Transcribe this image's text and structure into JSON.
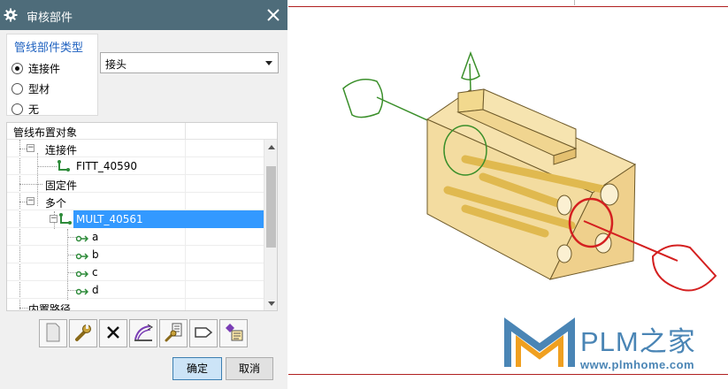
{
  "dialog": {
    "title": "审核部件",
    "part_type_group": {
      "legend": "管线部件类型",
      "options": [
        {
          "label": "连接件",
          "checked": true
        },
        {
          "label": "型材",
          "checked": false
        },
        {
          "label": "无",
          "checked": false
        }
      ]
    },
    "combo": {
      "value": "接头"
    },
    "tree": {
      "header": "管线布置对象",
      "rows": [
        {
          "label": "连接件",
          "expander": "−"
        },
        {
          "label": "FITT_40590"
        },
        {
          "label": "固定件"
        },
        {
          "label": "多个",
          "expander": "−"
        },
        {
          "label": "MULT_40561",
          "expander": "−",
          "selected": true
        },
        {
          "label": "a"
        },
        {
          "label": "b"
        },
        {
          "label": "c"
        },
        {
          "label": "d"
        },
        {
          "label": "内置路径"
        }
      ]
    },
    "toolbar_icons": [
      "blank-page-icon",
      "wrench-icon",
      "delete-x-icon",
      "route-path-icon",
      "edit-properties-icon",
      "tag-icon",
      "list-properties-icon"
    ],
    "buttons": {
      "ok": "确定",
      "cancel": "取消"
    }
  },
  "watermark": {
    "brand": "PLM之家",
    "url": "www.plmhome.com"
  },
  "colors": {
    "titlebar": "#4e6c7a",
    "selection": "#3399ff",
    "legend_text": "#1f62c0",
    "watermark": "#4a85b5",
    "red_port": "#d42020",
    "green_port": "#3a8f2a",
    "part_fill": "#f0d48c"
  }
}
